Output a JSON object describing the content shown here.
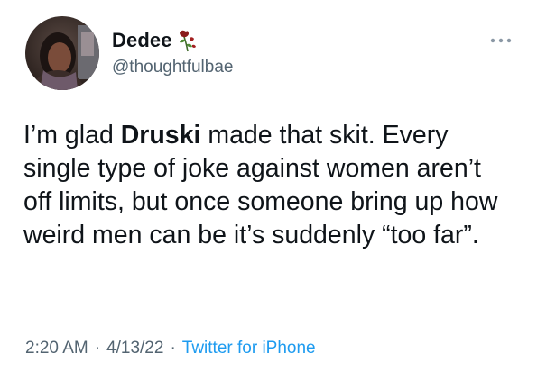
{
  "tweet": {
    "author": {
      "display_name": "Dedee",
      "badge_icon": "wilted-rose-icon",
      "handle": "@thoughtfulbae",
      "avatar_icon": "profile-photo"
    },
    "more_icon": "more-dots-icon",
    "text": {
      "part1": "I’m glad ",
      "mention": "Druski",
      "part2": " made that skit. Every single type of joke against women aren’t off limits, but once someone bring up how weird men can be it’s suddenly “too far”."
    },
    "meta": {
      "time": "2:20 AM",
      "separator": "·",
      "date": "4/13/22",
      "source": "Twitter for iPhone"
    },
    "colors": {
      "text": "#0f1419",
      "secondary": "#536471",
      "link": "#1d9bf0"
    }
  }
}
